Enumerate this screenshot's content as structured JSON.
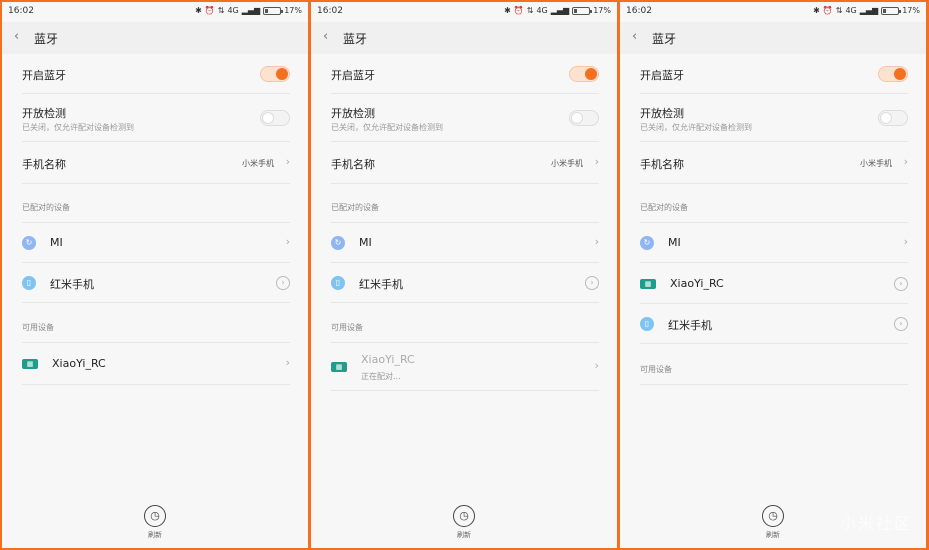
{
  "status": {
    "time": "16:02",
    "network": "4G",
    "battery": "17%"
  },
  "header": {
    "back": "‹",
    "title": "蓝牙"
  },
  "settings": {
    "bluetooth_on": "开启蓝牙",
    "discover": "开放检测",
    "discover_sub": "已关闭，仅允许配对设备检测到",
    "phone_name": "手机名称",
    "phone_name_value": "小米手机"
  },
  "sections": {
    "paired": "已配对的设备",
    "available": "可用设备"
  },
  "devices": {
    "mi": "MI",
    "redmi": "红米手机",
    "xiaoyi": "XiaoYi_RC",
    "pairing": "正在配对..."
  },
  "refresh_label": "刷新",
  "watermark": "小米社区",
  "colors": {
    "accent": "#f37021",
    "frame": "#f37021"
  }
}
